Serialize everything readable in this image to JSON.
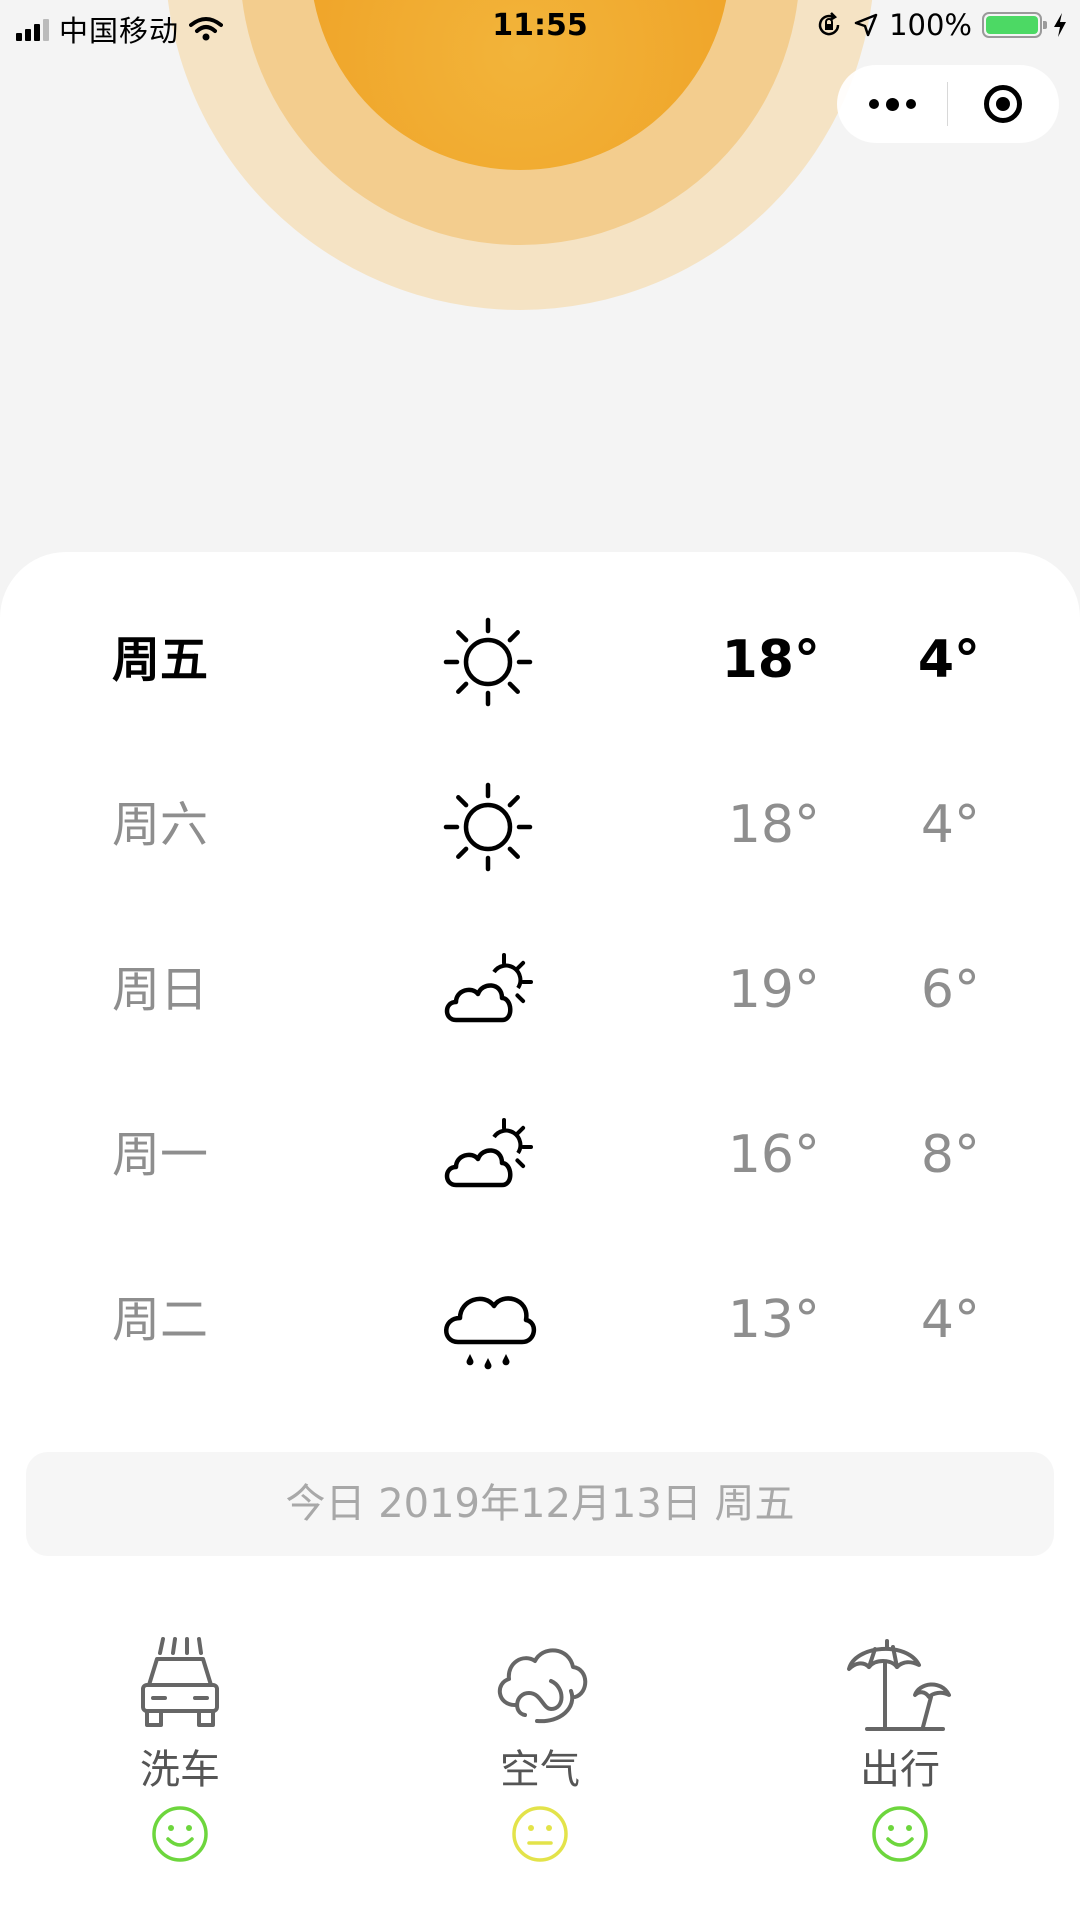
{
  "status_bar": {
    "carrier": "中国移动",
    "time": "11:55",
    "battery_percent": "100%",
    "battery_level": 1.0
  },
  "capsule": {
    "more_icon": "more-dots-icon",
    "close_icon": "target-close-icon"
  },
  "forecast": [
    {
      "day": "周五",
      "icon": "sunny-icon",
      "high": "18°",
      "low": "4°",
      "is_today": true
    },
    {
      "day": "周六",
      "icon": "sunny-icon",
      "high": "18°",
      "low": "4°",
      "is_today": false
    },
    {
      "day": "周日",
      "icon": "partly-cloudy-icon",
      "high": "19°",
      "low": "6°",
      "is_today": false
    },
    {
      "day": "周一",
      "icon": "partly-cloudy-icon",
      "high": "16°",
      "low": "8°",
      "is_today": false
    },
    {
      "day": "周二",
      "icon": "rain-icon",
      "high": "13°",
      "low": "4°",
      "is_today": false
    }
  ],
  "today_bar": "今日 2019年12月13日 周五",
  "tips": [
    {
      "label": "洗车",
      "icon": "car-wash-icon",
      "mood": "happy",
      "mood_color": "#6dd63d"
    },
    {
      "label": "空气",
      "icon": "air-icon",
      "mood": "neutral",
      "mood_color": "#e3e34a"
    },
    {
      "label": "出行",
      "icon": "beach-umbrella-icon",
      "mood": "happy",
      "mood_color": "#6dd63d"
    }
  ],
  "colors": {
    "sun_core": "#f0a62b",
    "sun_mid": "#f3cd8e",
    "sun_outer": "#f5e3c4",
    "background": "#f4f4f4"
  }
}
